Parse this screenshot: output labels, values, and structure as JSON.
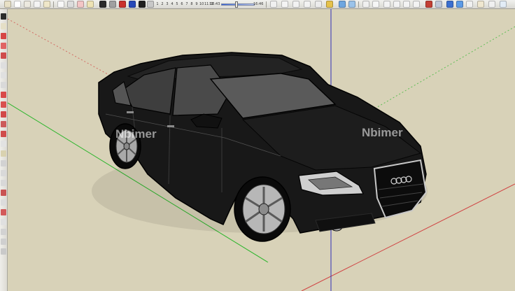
{
  "app": {
    "name": "SketchUp"
  },
  "toolbar": {
    "scene_tabs": [
      "1",
      "2",
      "3",
      "4",
      "5",
      "6",
      "7",
      "8",
      "9",
      "10",
      "11",
      "12"
    ],
    "time_start": "06:43",
    "time_end": "16:46",
    "shadow_time_position": 0.45
  },
  "viewport": {
    "background_color": "#d8d2b8",
    "axes": {
      "red": "#d04040",
      "green": "#2bb52b",
      "blue": "#3030b8"
    },
    "watermarks": [
      "Nbimer",
      "Nbimer"
    ],
    "model": {
      "subject": "black sedan",
      "body_color": "#181818",
      "edge_color": "#000000"
    }
  }
}
